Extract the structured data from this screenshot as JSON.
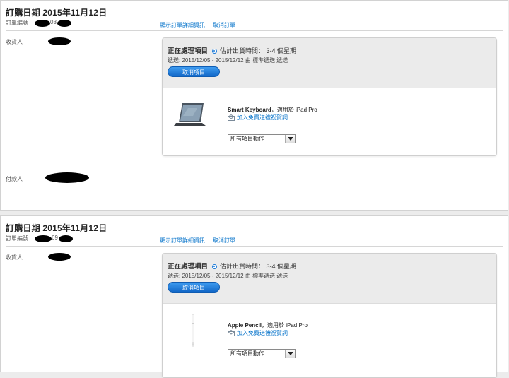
{
  "orders": [
    {
      "date_label": "訂購日期 2015年11月12日",
      "order_number_label": "訂單編號",
      "order_number_visible": "03",
      "links": {
        "details": "顯示訂單詳細資訊",
        "cancel": "取消訂單"
      },
      "recipient_label": "收貨人",
      "payer_label": "付款人",
      "item": {
        "status": "正在處理項目",
        "ship_estimate": "估計出貨時間： 3-4 個星期",
        "delivery": "遞送: 2015/12/05 - 2015/12/12 由 標準遞送 遞送",
        "cancel_button": "取消項目",
        "product_name": "Smart Keyboard",
        "product_suffix": "，適用於 iPad Pro",
        "gift_link": "加入免費送禮祝賀詞",
        "action_select": "所有項目動作"
      }
    },
    {
      "date_label": "訂購日期 2015年11月12日",
      "order_number_label": "訂單編號",
      "order_number_visible": "69",
      "links": {
        "details": "顯示訂單詳細資訊",
        "cancel": "取消訂單"
      },
      "recipient_label": "收貨人",
      "item": {
        "status": "正在處理項目",
        "ship_estimate": "估計出貨時間： 3-4 個星期",
        "delivery": "遞送: 2015/12/05 - 2015/12/12 由 標準遞送 遞送",
        "cancel_button": "取消項目",
        "product_name": "Apple Pencil",
        "product_suffix": "，適用於 iPad Pro",
        "gift_link": "加入免費送禮祝賀詞",
        "action_select": "所有項目動作"
      }
    }
  ],
  "colors": {
    "link": "#0070c9",
    "button": "#1a7ad9",
    "redaction": "#000000"
  },
  "icons": {
    "status": "radio-dot-icon",
    "gift": "envelope-icon",
    "select": "chevron-down-icon"
  }
}
